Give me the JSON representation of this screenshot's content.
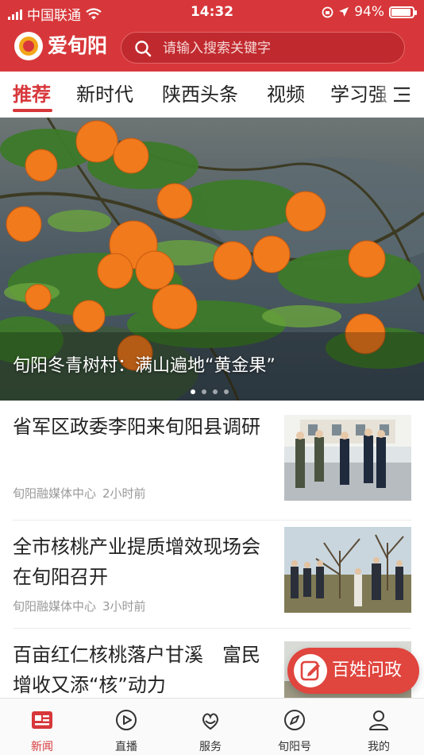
{
  "status_bar": {
    "carrier": "中国联通",
    "time": "14:32",
    "battery": "94%",
    "battery_level": 0.94
  },
  "header": {
    "app_name": "爱旬阳",
    "search_placeholder": "请输入搜索关键字"
  },
  "tabs": [
    {
      "label": "推荐",
      "active": true
    },
    {
      "label": "新时代",
      "active": false
    },
    {
      "label": "陕西头条",
      "active": false
    },
    {
      "label": "视频",
      "active": false
    },
    {
      "label": "学习强",
      "active": false
    }
  ],
  "banner": {
    "caption": "旬阳冬青树村：满山遍地“黄金果”",
    "slide_count": 4,
    "active_slide": 1
  },
  "news": [
    {
      "title": "省军区政委李阳来旬阳县调研",
      "source": "旬阳融媒体中心",
      "time": "2小时前"
    },
    {
      "title": "全市核桃产业提质增效现场会在旬阳召开",
      "source": "旬阳融媒体中心",
      "time": "3小时前"
    },
    {
      "title": "百亩红仁核桃落户甘溪　富民增收又添“核”动力",
      "source": "",
      "time": ""
    }
  ],
  "fab": {
    "label": "百姓问政"
  },
  "bottom_nav": [
    {
      "label": "新闻",
      "icon": "news-icon",
      "active": true
    },
    {
      "label": "直播",
      "icon": "live-play-icon",
      "active": false
    },
    {
      "label": "服务",
      "icon": "service-icon",
      "active": false
    },
    {
      "label": "旬阳号",
      "icon": "compass-icon",
      "active": false
    },
    {
      "label": "我的",
      "icon": "user-icon",
      "active": false
    }
  ],
  "colors": {
    "brand_red": "#d7373a",
    "fab_red": "#e0453e"
  }
}
